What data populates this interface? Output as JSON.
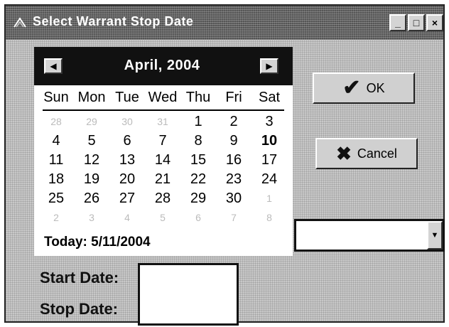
{
  "window": {
    "title": "Select Warrant Stop Date",
    "min_glyph": "_",
    "max_glyph": "□",
    "close_glyph": "×"
  },
  "calendar": {
    "month_label": "April, 2004",
    "prev_glyph": "◀",
    "next_glyph": "▶",
    "day_names": [
      "Sun",
      "Mon",
      "Tue",
      "Wed",
      "Thu",
      "Fri",
      "Sat"
    ],
    "weeks": [
      [
        {
          "d": "28",
          "m": true
        },
        {
          "d": "29",
          "m": true
        },
        {
          "d": "30",
          "m": true
        },
        {
          "d": "31",
          "m": true
        },
        {
          "d": "1"
        },
        {
          "d": "2"
        },
        {
          "d": "3"
        }
      ],
      [
        {
          "d": "4"
        },
        {
          "d": "5"
        },
        {
          "d": "6"
        },
        {
          "d": "7"
        },
        {
          "d": "8"
        },
        {
          "d": "9"
        },
        {
          "d": "10",
          "t": true
        }
      ],
      [
        {
          "d": "11"
        },
        {
          "d": "12"
        },
        {
          "d": "13"
        },
        {
          "d": "14"
        },
        {
          "d": "15"
        },
        {
          "d": "16"
        },
        {
          "d": "17"
        }
      ],
      [
        {
          "d": "18"
        },
        {
          "d": "19"
        },
        {
          "d": "20"
        },
        {
          "d": "21"
        },
        {
          "d": "22"
        },
        {
          "d": "23"
        },
        {
          "d": "24"
        }
      ],
      [
        {
          "d": "25"
        },
        {
          "d": "26"
        },
        {
          "d": "27"
        },
        {
          "d": "28"
        },
        {
          "d": "29"
        },
        {
          "d": "30"
        },
        {
          "d": "1",
          "m": true
        }
      ],
      [
        {
          "d": "2",
          "m": true
        },
        {
          "d": "3",
          "m": true
        },
        {
          "d": "4",
          "m": true
        },
        {
          "d": "5",
          "m": true
        },
        {
          "d": "6",
          "m": true
        },
        {
          "d": "7",
          "m": true
        },
        {
          "d": "8",
          "m": true
        }
      ]
    ],
    "today_text": "Today: 5/11/2004"
  },
  "buttons": {
    "ok_label": "OK",
    "ok_icon": "checkmark-icon",
    "cancel_label": "Cancel",
    "cancel_icon": "x-icon"
  },
  "combo": {
    "value": "",
    "arrow_glyph": "▼"
  },
  "fields": {
    "start_label": "Start Date:",
    "stop_label": "Stop Date:",
    "start_value": "",
    "stop_value": ""
  }
}
